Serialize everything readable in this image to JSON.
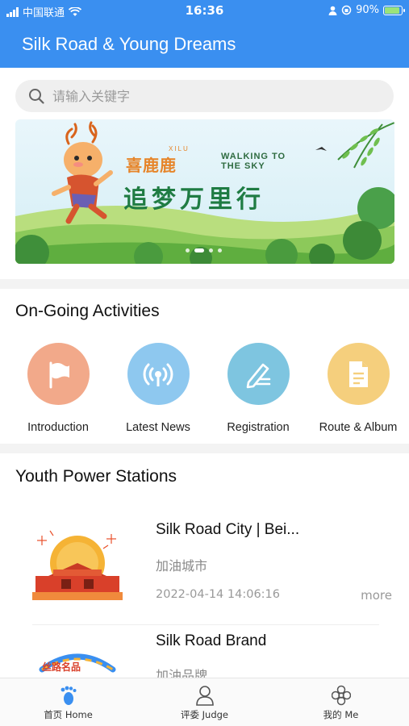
{
  "status_bar": {
    "carrier": "中国联通",
    "time": "16:36",
    "battery": "90%",
    "battery_level": 0.9
  },
  "header": {
    "title": "Silk Road & Young Dreams"
  },
  "search": {
    "placeholder": "请输入关键字"
  },
  "banner": {
    "logo": "喜鹿鹿",
    "logo_small": "XILU",
    "tagline_1": "WALKING TO",
    "tagline_2": "THE SKY",
    "slogan": "追梦万里行",
    "slide_count": 4,
    "active_slide": 1
  },
  "activities": {
    "title": "On-Going Activities",
    "items": [
      {
        "label": "Introduction",
        "icon": "flag-icon",
        "color": "#f2a98a"
      },
      {
        "label": "Latest News",
        "icon": "broadcast-icon",
        "color": "#8ec8ef"
      },
      {
        "label": "Registration",
        "icon": "pen-icon",
        "color": "#7ec5e0"
      },
      {
        "label": "Route & Album",
        "icon": "document-icon",
        "color": "#f5cf7d"
      }
    ]
  },
  "stations": {
    "title": "Youth Power Stations",
    "items": [
      {
        "name": "Silk Road City | Bei...",
        "sub": "加油城市",
        "date": "2022-04-14 14:06:16",
        "more": "more"
      },
      {
        "name": "Silk Road Brand",
        "sub": "加油品牌",
        "thumb_text": "丝路名品"
      }
    ]
  },
  "tabbar": {
    "items": [
      {
        "label": "首页 Home",
        "icon": "footprint-icon"
      },
      {
        "label": "评委 Judge",
        "icon": "person-icon"
      },
      {
        "label": "我的 Me",
        "icon": "flower-icon"
      }
    ]
  }
}
